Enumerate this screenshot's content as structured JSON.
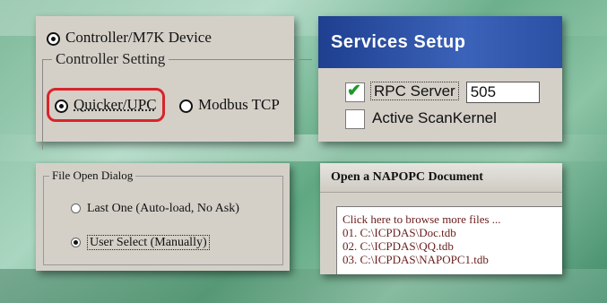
{
  "panel_controller": {
    "device_option": "Controller/M7K Device",
    "group_title": "Controller Setting",
    "option_quicker": "Quicker/UPC",
    "option_modbus": "Modbus TCP"
  },
  "panel_services": {
    "title": "Services Setup",
    "rpc_label": "RPC Server",
    "rpc_port": "505",
    "scan_label": "Active ScanKernel"
  },
  "panel_file": {
    "group_title": "File Open Dialog",
    "option_last": "Last One (Auto-load, No Ask)",
    "option_user": "User Select (Manually)"
  },
  "panel_open": {
    "title": "Open a NAPOPC Document",
    "items": [
      "Click here to browse more files ...",
      "01. C:\\ICPDAS\\Doc.tdb",
      "02. C:\\ICPDAS\\QQ.tdb",
      "03. C:\\ICPDAS\\NAPOPC1.tdb"
    ]
  },
  "colors": {
    "highlight_ring": "#d9252a",
    "titlebar_blue": "#2b50a4",
    "check_green": "#1c9a2a"
  }
}
